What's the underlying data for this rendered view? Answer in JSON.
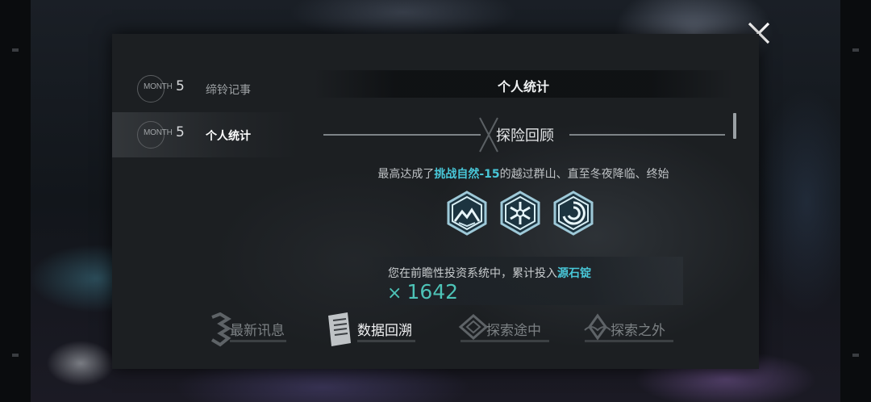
{
  "window": {
    "close_label": "close"
  },
  "sidebar": {
    "items": [
      {
        "month_word": "MONTH",
        "month_num": "5",
        "label": "缔铃记事",
        "active": false
      },
      {
        "month_word": "MONTH",
        "month_num": "5",
        "label": "个人统计",
        "active": true
      }
    ]
  },
  "content": {
    "title": "个人统计",
    "section_heading": "探险回顾",
    "summary": {
      "prefix": "最高达成了",
      "highlight": "挑战自然-15",
      "suffix": "的越过群山、直至冬夜降临、终始"
    },
    "badges": [
      "mountain-badge-icon",
      "snowflake-badge-icon",
      "spiral-badge-icon"
    ],
    "investment": {
      "prefix": "您在前瞻性投资系统中，累计投入",
      "highlight": "源石锭",
      "multiplier": "×",
      "value": "1642"
    }
  },
  "tabs": [
    {
      "label": "最新讯息",
      "icon": "news-icon",
      "active": false
    },
    {
      "label": "数据回溯",
      "icon": "document-icon",
      "active": true
    },
    {
      "label": "探索途中",
      "icon": "compass-diamond-icon",
      "active": false
    },
    {
      "label": "探索之外",
      "icon": "leaf-icon",
      "active": false
    }
  ],
  "colors": {
    "accent": "#48c7d8",
    "value_green": "#4dc3b7",
    "panel_bg": "#1c1f22"
  }
}
